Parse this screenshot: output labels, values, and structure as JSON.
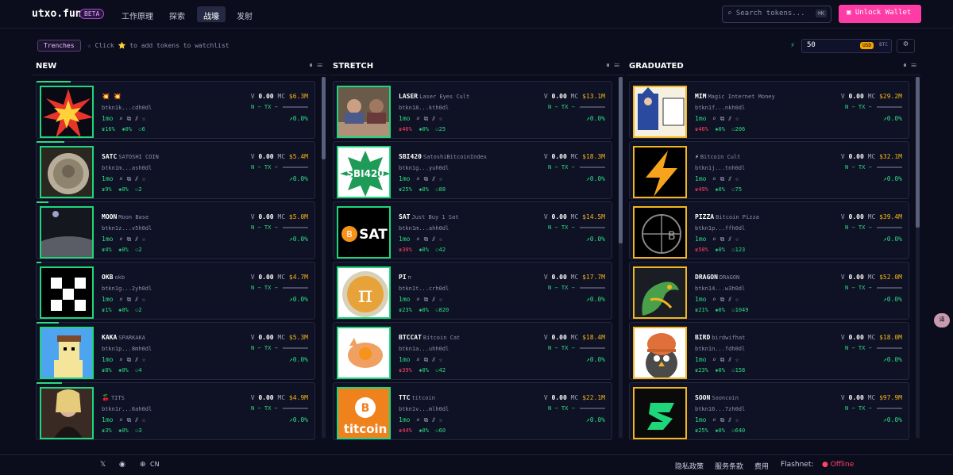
{
  "header": {
    "logo": "utxo.fun",
    "beta": "BETA",
    "nav": [
      "工作原理",
      "探索",
      "战壕",
      "发射"
    ],
    "search_placeholder": "Search tokens...",
    "search_kbd": "⌘K",
    "wallet": "Unlock Wallet"
  },
  "subbar": {
    "trenches": "Trenches",
    "hint": "☆ Click ⭐ to add tokens to watchlist",
    "amount": "50",
    "usd": "USD",
    "btc": "BTC"
  },
  "columns": [
    {
      "title": "NEW",
      "tokens": [
        {
          "symbol": "💥 💥",
          "name": "",
          "addr": "btkn1k...cdh0dl",
          "v": "0.00",
          "mc": "$6.3M",
          "age": "1mo",
          "a": "16%",
          "b": "0%",
          "c": "6",
          "pct": "0.0%",
          "red": false,
          "bar": 0.62,
          "art": "burst"
        },
        {
          "symbol": "SATC",
          "name": "SATOSHI COIN",
          "addr": "btkn1m...ash0dl",
          "v": "0.00",
          "mc": "$5.4M",
          "age": "1mo",
          "a": "9%",
          "b": "0%",
          "c": "2",
          "pct": "0.0%",
          "red": false,
          "bar": 0.5,
          "art": "coin"
        },
        {
          "symbol": "MOON",
          "name": "Moon Base",
          "addr": "btkn1z...v5h0dl",
          "v": "0.00",
          "mc": "$5.0M",
          "age": "1mo",
          "a": "4%",
          "b": "0%",
          "c": "2",
          "pct": "0.0%",
          "red": false,
          "bar": 0.22,
          "art": "moon"
        },
        {
          "symbol": "OKB",
          "name": "okb",
          "addr": "btkn1g...2yh0dl",
          "v": "0.00",
          "mc": "$4.7M",
          "age": "1mo",
          "a": "1%",
          "b": "0%",
          "c": "2",
          "pct": "0.0%",
          "red": false,
          "bar": 0.08,
          "art": "okb"
        },
        {
          "symbol": "KAKA",
          "name": "SPARKAKA",
          "addr": "btkn1p...8mh0dl",
          "v": "0.00",
          "mc": "$5.3M",
          "age": "1mo",
          "a": "8%",
          "b": "0%",
          "c": "4",
          "pct": "0.0%",
          "red": false,
          "bar": 0.4,
          "art": "kaka"
        },
        {
          "symbol": "🍒",
          "name": "TITS",
          "addr": "btkn1r...6ah0dl",
          "v": "0.00",
          "mc": "$4.9M",
          "age": "1mo",
          "a": "3%",
          "b": "0%",
          "c": "3",
          "pct": "0.0%",
          "red": false,
          "bar": 0.45,
          "art": "photo"
        }
      ]
    },
    {
      "title": "STRETCH",
      "tokens": [
        {
          "symbol": "LASER",
          "name": "Laser Eyes Cult",
          "addr": "btkn18...kth0dl",
          "v": "0.00",
          "mc": "$13.1M",
          "age": "1mo",
          "a": "46%",
          "b": "0%",
          "c": "25",
          "pct": "0.0%",
          "red": true,
          "art": "laser"
        },
        {
          "symbol": "SBI420",
          "name": "SatoshiBitcoinIndex",
          "addr": "btkn1g...yuh0dl",
          "v": "0.00",
          "mc": "$18.3M",
          "age": "1mo",
          "a": "25%",
          "b": "0%",
          "c": "88",
          "pct": "0.0%",
          "red": false,
          "art": "sbi"
        },
        {
          "symbol": "SAT",
          "name": "Just Buy 1 Sat",
          "addr": "btkn1m...ahh0dl",
          "v": "0.00",
          "mc": "$14.5M",
          "age": "1mo",
          "a": "30%",
          "b": "0%",
          "c": "42",
          "pct": "0.0%",
          "red": true,
          "art": "sat"
        },
        {
          "symbol": "PI",
          "name": "π",
          "addr": "btkn1t...crh0dl",
          "v": "0.00",
          "mc": "$17.7M",
          "age": "1mo",
          "a": "23%",
          "b": "0%",
          "c": "820",
          "pct": "0.0%",
          "red": false,
          "art": "pi"
        },
        {
          "symbol": "BTCCAT",
          "name": "Bitcoin Cat",
          "addr": "btkn1a...uhh0dl",
          "v": "0.00",
          "mc": "$18.4M",
          "age": "1mo",
          "a": "39%",
          "b": "0%",
          "c": "42",
          "pct": "0.0%",
          "red": true,
          "art": "cat"
        },
        {
          "symbol": "TTC",
          "name": "titcoin",
          "addr": "btkn1v...mlh0dl",
          "v": "0.00",
          "mc": "$22.1M",
          "age": "1mo",
          "a": "44%",
          "b": "0%",
          "c": "60",
          "pct": "0.0%",
          "red": true,
          "art": "ttc"
        }
      ]
    },
    {
      "title": "GRADUATED",
      "tokens": [
        {
          "symbol": "MIM",
          "name": "Magic Internet Money",
          "addr": "btkn1f...nkh0dl",
          "v": "0.00",
          "mc": "$29.2M",
          "age": "1mo",
          "a": "46%",
          "b": "0%",
          "c": "206",
          "pct": "0.0%",
          "red": true,
          "art": "mim"
        },
        {
          "symbol": "⚡",
          "name": "Bitcoin Cult",
          "addr": "btkn1j...tnh0dl",
          "v": "0.00",
          "mc": "$32.1M",
          "age": "1mo",
          "a": "49%",
          "b": "0%",
          "c": "75",
          "pct": "0.0%",
          "red": true,
          "art": "bolt"
        },
        {
          "symbol": "PIZZA",
          "name": "Bitcoin Pizza",
          "addr": "btkn1p...ffh0dl",
          "v": "0.00",
          "mc": "$39.4M",
          "age": "1mo",
          "a": "50%",
          "b": "0%",
          "c": "123",
          "pct": "0.0%",
          "red": true,
          "art": "pizza"
        },
        {
          "symbol": "DRAGON",
          "name": "DRAGON",
          "addr": "btkn14...w3h0dl",
          "v": "0.00",
          "mc": "$52.0M",
          "age": "1mo",
          "a": "21%",
          "b": "0%",
          "c": "1049",
          "pct": "0.0%",
          "red": false,
          "art": "dragon"
        },
        {
          "symbol": "BIRD",
          "name": "birdwifhat",
          "addr": "btkn1n...fdh0dl",
          "v": "0.00",
          "mc": "$18.0M",
          "age": "1mo",
          "a": "23%",
          "b": "0%",
          "c": "158",
          "pct": "0.0%",
          "red": false,
          "art": "bird"
        },
        {
          "symbol": "SOON",
          "name": "Sooncoin",
          "addr": "btkn16...7zh0dl",
          "v": "0.00",
          "mc": "$97.9M",
          "age": "1mo",
          "a": "25%",
          "b": "0%",
          "c": "640",
          "pct": "0.0%",
          "red": false,
          "art": "soon"
        }
      ]
    }
  ],
  "labels": {
    "v": "V",
    "mc": "MC",
    "n": "N",
    "tx": "TX",
    "dash": "−"
  },
  "footer": {
    "x": "𝕏",
    "lang": "CN",
    "privacy": "隐私政策",
    "terms": "服务条款",
    "fees": "费用",
    "flashnet": "Flashnet:",
    "status": "Offline"
  },
  "translate": "译"
}
